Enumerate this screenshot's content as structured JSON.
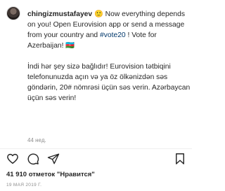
{
  "post": {
    "username": "chingizmustafayev",
    "caption_part1": " 🙂 Now everything depends on you! Open Eurovision app or send a message from your country and ",
    "hashtag": "#vote20",
    "caption_part2": " ! Vote for Azerbaijan! 🇦🇿",
    "caption_az": "İndi hər şey sizə bağlıdır! Eurovision tətbiqini telefonunuzda açın və ya öz ölkənizdən səs göndərin, 20# nömrəsi üçün səs verin. Azərbaycan üçün səs verin!",
    "time_ago": "44 нед."
  },
  "actions": {
    "like_icon": "heart-icon",
    "comment_icon": "comment-icon",
    "share_icon": "share-icon",
    "save_icon": "bookmark-icon"
  },
  "likes": {
    "text": "41 910 отметок \"Нравится\""
  },
  "date": {
    "text": "19 МАЯ 2019 Г."
  },
  "colors": {
    "text": "#262626",
    "muted": "#8e8e8e",
    "hashtag": "#00376b",
    "divider": "#efefef"
  }
}
